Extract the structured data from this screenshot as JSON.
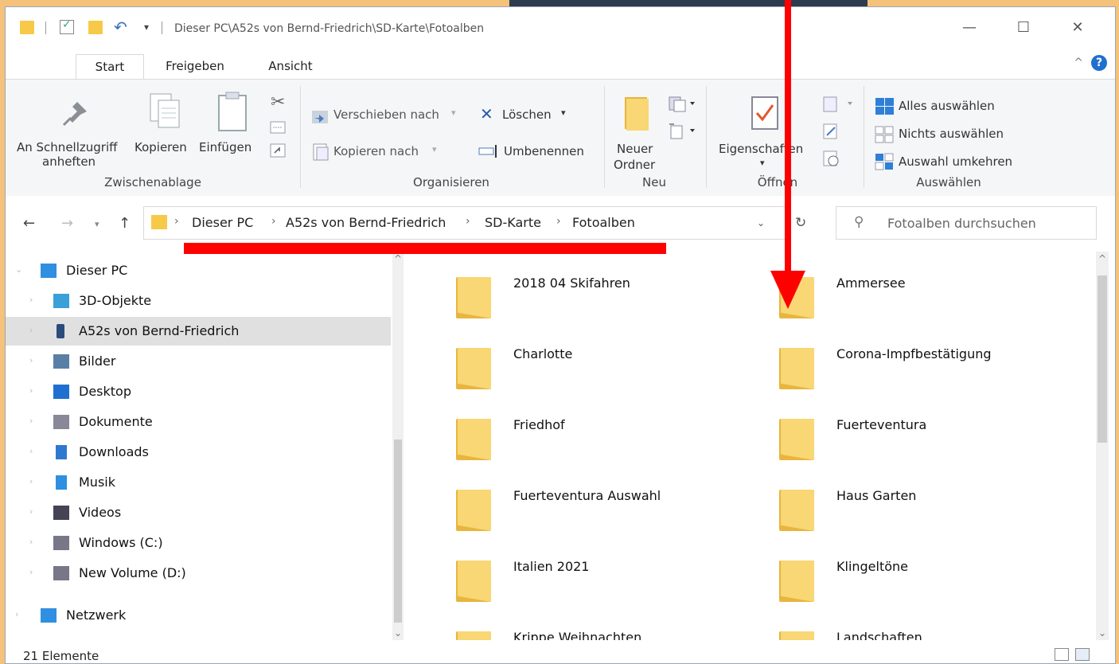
{
  "window": {
    "title": "Dieser PC\\A52s von Bernd-Friedrich\\SD-Karte\\Fotoalben",
    "minimize": "—",
    "maximize": "☐",
    "close": "✕"
  },
  "tabs": [
    "Start",
    "Freigeben",
    "Ansicht"
  ],
  "help_label": "?",
  "ribbon": {
    "pin_label_1": "An Schnellzugriff",
    "pin_label_2": "anheften",
    "copy": "Kopieren",
    "paste": "Einfügen",
    "move_to": "Verschieben nach",
    "copy_to": "Kopieren nach",
    "delete": "Löschen",
    "rename": "Umbenennen",
    "new_folder_1": "Neuer",
    "new_folder_2": "Ordner",
    "properties": "Eigenschaften",
    "select_all": "Alles auswählen",
    "select_none": "Nichts auswählen",
    "invert_selection": "Auswahl umkehren",
    "groups": [
      "Zwischenablage",
      "Organisieren",
      "Neu",
      "Öffnen",
      "Auswählen"
    ]
  },
  "address": {
    "crumbs": [
      "Dieser PC",
      "A52s von Bernd-Friedrich",
      "SD-Karte",
      "Fotoalben"
    ],
    "separator": "›"
  },
  "search": {
    "placeholder": "Fotoalben durchsuchen"
  },
  "nav_pane": {
    "items": [
      {
        "label": "Dieser PC",
        "icon": "computer-icon"
      },
      {
        "label": "3D-Objekte",
        "icon": "cube-icon"
      },
      {
        "label": "A52s von Bernd-Friedrich",
        "icon": "phone-icon",
        "selected": true
      },
      {
        "label": "Bilder",
        "icon": "pictures-icon"
      },
      {
        "label": "Desktop",
        "icon": "desktop-icon"
      },
      {
        "label": "Dokumente",
        "icon": "document-icon"
      },
      {
        "label": "Downloads",
        "icon": "download-icon"
      },
      {
        "label": "Musik",
        "icon": "music-icon"
      },
      {
        "label": "Videos",
        "icon": "video-icon"
      },
      {
        "label": "Windows (C:)",
        "icon": "drive-icon"
      },
      {
        "label": "New Volume (D:)",
        "icon": "drive-icon"
      },
      {
        "label": "Netzwerk",
        "icon": "network-icon"
      }
    ]
  },
  "folders": [
    "2018 04 Skifahren",
    "Ammersee",
    "Charlotte",
    "Corona-Impfbestätigung",
    "Friedhof",
    "Fuerteventura",
    "Fuerteventura Auswahl",
    "Haus Garten",
    "Italien 2021",
    "Klingeltöne",
    "Krippe Weihnachten",
    "Landschaften"
  ],
  "status": {
    "text": "21 Elemente"
  },
  "colors": {
    "folder": "#f8d774",
    "annotation": "#ff0000",
    "accent": "#1f6fd0",
    "background": "#f4c27a"
  }
}
